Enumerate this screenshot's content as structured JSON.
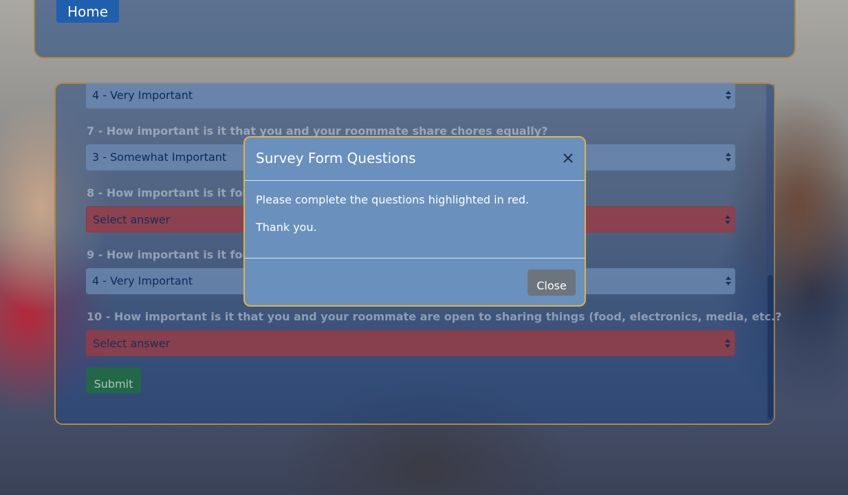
{
  "header": {
    "home_label": "Home"
  },
  "survey": {
    "items": [
      {
        "question": "",
        "selected": "4 - Very Important",
        "status": "ok"
      },
      {
        "question": "7 - How important is it that you and your roommate share chores equally?",
        "selected": "3 - Somewhat Important",
        "status": "ok"
      },
      {
        "question": "8 - How important is it for you and your roommate to have a quiet room?",
        "selected": "Select answer",
        "status": "error"
      },
      {
        "question": "9 - How important is it for you and your roommate to have a clean room?",
        "selected": "4 - Very Important",
        "status": "ok"
      },
      {
        "question": "10 - How important is it that you and your roommate are open to sharing things (food, electronics, media, etc.?",
        "selected": "Select answer",
        "status": "error"
      }
    ],
    "submit_label": "Submit"
  },
  "modal": {
    "title": "Survey Form Questions",
    "body": [
      "Please complete the questions highlighted in red.",
      "Thank you."
    ],
    "close_label": "Close",
    "close_icon": "close-icon"
  },
  "colors": {
    "modal_background": "#6a91bd",
    "modal_border": "#e3b43e",
    "error_select": "#963c46",
    "home_button": "#1f5fae",
    "submit_button": "#1e6e3c",
    "close_button": "#6c757d"
  }
}
